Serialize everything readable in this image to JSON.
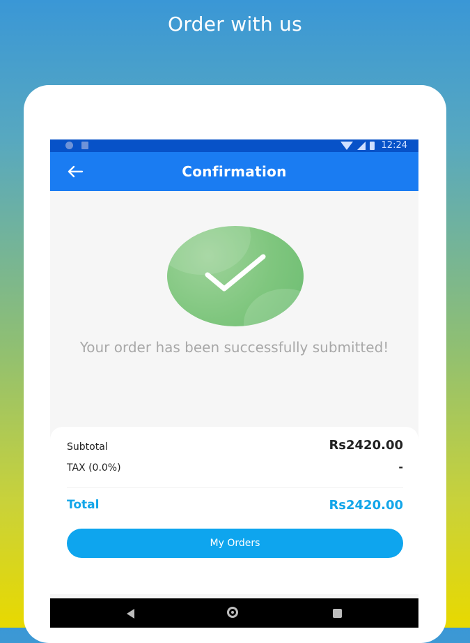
{
  "headline": "Order with us",
  "status_bar": {
    "time": "12:24",
    "icons": [
      "notification-dot-icon",
      "sd-card-icon",
      "wifi-icon",
      "signal-icon",
      "battery-icon"
    ]
  },
  "app_bar": {
    "title": "Confirmation",
    "back_icon": "back-arrow-icon",
    "color": "#1a7cf2"
  },
  "confirmation": {
    "icon": "checkmark-circle-icon",
    "message": "Your order has been successfully submitted!"
  },
  "summary": {
    "subtotal_label": "Subtotal",
    "subtotal_value": "Rs2420.00",
    "tax_label": "TAX (0.0%)",
    "tax_value": "-",
    "total_label": "Total",
    "total_value": "Rs2420.00",
    "accent_color": "#13a6e9"
  },
  "buttons": {
    "my_orders": "My Orders"
  },
  "nav_bar": {
    "icons": [
      "nav-back-icon",
      "nav-home-icon",
      "nav-recents-icon"
    ]
  }
}
